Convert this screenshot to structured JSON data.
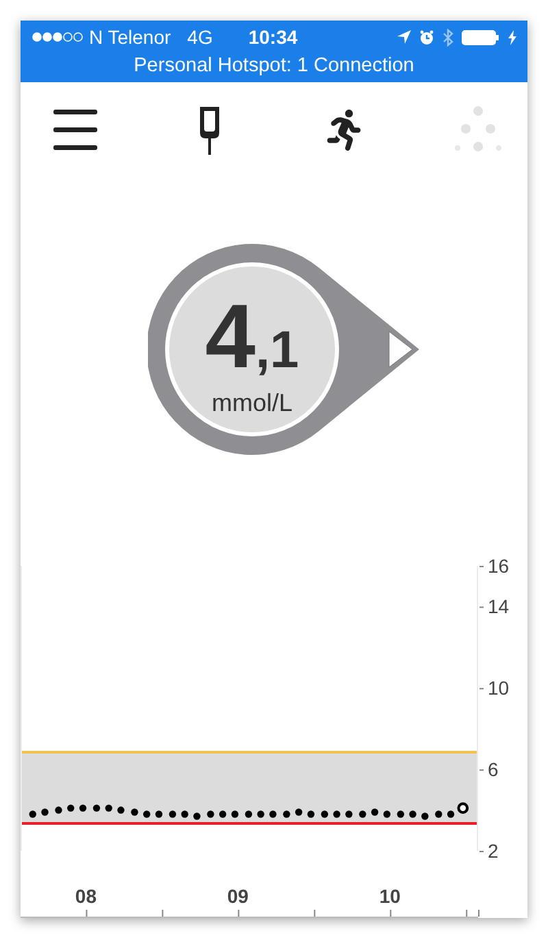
{
  "status_bar": {
    "carrier": "N Telenor",
    "network": "4G",
    "time": "10:34",
    "hotspot": "Personal Hotspot: 1 Connection"
  },
  "reading": {
    "whole": "4",
    "fraction": ",1",
    "unit": "mmol/L"
  },
  "chart": {
    "chart_data": {
      "type": "scatter",
      "x": [
        7.65,
        7.73,
        7.82,
        7.9,
        7.98,
        8.07,
        8.15,
        8.23,
        8.32,
        8.4,
        8.48,
        8.57,
        8.65,
        8.73,
        8.82,
        8.9,
        8.98,
        9.07,
        9.15,
        9.23,
        9.32,
        9.4,
        9.48,
        9.57,
        9.65,
        9.73,
        9.82,
        9.9,
        9.98,
        10.07,
        10.15,
        10.23,
        10.32,
        10.4,
        10.48
      ],
      "series": [
        {
          "color": "#000000",
          "values": [
            3.8,
            3.9,
            4.0,
            4.1,
            4.1,
            4.1,
            4.1,
            4.0,
            3.9,
            3.8,
            3.8,
            3.8,
            3.8,
            3.7,
            3.8,
            3.8,
            3.8,
            3.8,
            3.8,
            3.8,
            3.8,
            3.9,
            3.8,
            3.8,
            3.8,
            3.8,
            3.8,
            3.9,
            3.8,
            3.8,
            3.8,
            3.7,
            3.8,
            3.8,
            4.1
          ]
        }
      ],
      "xlim": [
        7.57,
        10.58
      ],
      "ylim": [
        2,
        16
      ],
      "xticks": [
        {
          "value": 8,
          "label": "08"
        },
        {
          "value": 9,
          "label": "09"
        },
        {
          "value": 10,
          "label": "10"
        }
      ],
      "yticks": [
        2,
        6,
        10,
        14,
        16
      ]
    }
  }
}
